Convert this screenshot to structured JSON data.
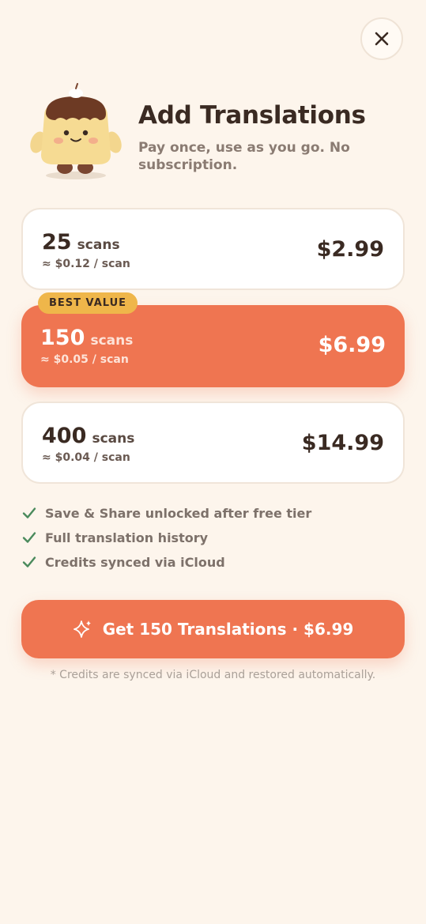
{
  "header": {
    "title": "Add Translations",
    "subtitle": "Pay once, use as you go. No subscription.",
    "close_icon": "close-icon",
    "mascot": "flan-pudding-mascot"
  },
  "plans": [
    {
      "qty": "25",
      "unit": "scans",
      "per_scan": "≈ $0.12 / scan",
      "price": "$2.99",
      "selected": false
    },
    {
      "qty": "150",
      "unit": "scans",
      "per_scan": "≈ $0.05 / scan",
      "price": "$6.99",
      "selected": true,
      "badge": "BEST VALUE"
    },
    {
      "qty": "400",
      "unit": "scans",
      "per_scan": "≈ $0.04 / scan",
      "price": "$14.99",
      "selected": false
    }
  ],
  "features": [
    "Save & Share unlocked after free tier",
    "Full translation history",
    "Credits synced via iCloud"
  ],
  "cta": {
    "label": "Get 150 Translations · $6.99",
    "icon": "sparkle-icon"
  },
  "footnote": "* Credits are synced via iCloud and restored automatically.",
  "colors": {
    "background": "#fdf5ec",
    "accent": "#ef7551",
    "badge": "#efb64a",
    "check": "#4a8a5c",
    "text_dark": "#3a2a22"
  }
}
